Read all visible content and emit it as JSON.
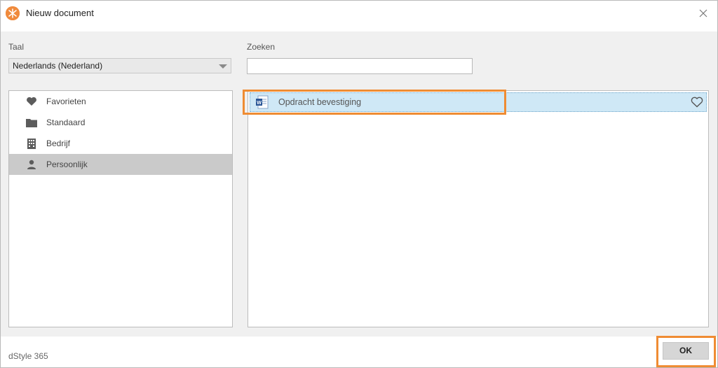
{
  "window": {
    "title": "Nieuw document"
  },
  "language": {
    "label": "Taal",
    "selected": "Nederlands (Nederland)"
  },
  "search": {
    "label": "Zoeken",
    "value": "",
    "placeholder": ""
  },
  "categories": [
    {
      "label": "Favorieten",
      "icon": "heart-icon",
      "selected": false
    },
    {
      "label": "Standaard",
      "icon": "folder-icon",
      "selected": false
    },
    {
      "label": "Bedrijf",
      "icon": "building-icon",
      "selected": false
    },
    {
      "label": "Persoonlijk",
      "icon": "person-icon",
      "selected": true
    }
  ],
  "documents": [
    {
      "label": "Opdracht bevestiging",
      "icon": "word-document-icon",
      "selected": true,
      "favorite": false
    }
  ],
  "footer": {
    "product": "dStyle 365",
    "ok_label": "OK"
  },
  "colors": {
    "accent": "#ef8c33",
    "selection": "#cfe8f6",
    "category_selected": "#cacaca",
    "logo": "#f08a3c"
  }
}
